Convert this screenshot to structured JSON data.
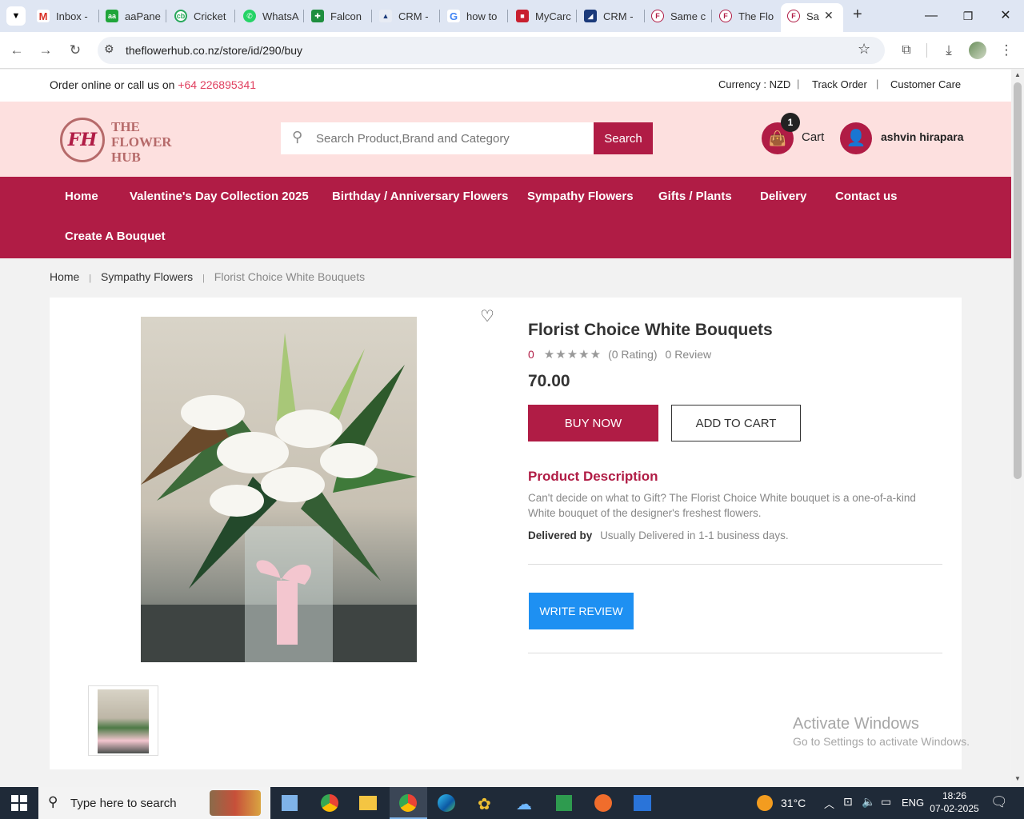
{
  "browser": {
    "tabs": [
      {
        "title": "Inbox -",
        "icon": "gmail-icon"
      },
      {
        "title": "aaPane",
        "icon": "aapanel-icon"
      },
      {
        "title": "Cricket",
        "icon": "cricket-icon"
      },
      {
        "title": "WhatsA",
        "icon": "whatsapp-icon"
      },
      {
        "title": "Falcon",
        "icon": "falcon-icon"
      },
      {
        "title": "CRM -",
        "icon": "crm-icon"
      },
      {
        "title": "how to",
        "icon": "google-icon"
      },
      {
        "title": "MyCarc",
        "icon": "mycard-icon"
      },
      {
        "title": "CRM -",
        "icon": "crm-icon"
      },
      {
        "title": "Same c",
        "icon": "flowerhub-icon"
      },
      {
        "title": "The Flo",
        "icon": "flowerhub-icon"
      },
      {
        "title": "Sa",
        "icon": "flowerhub-icon"
      }
    ],
    "url": "theflowerhub.co.nz/store/id/290/buy"
  },
  "topbar": {
    "call_text": "Order online or call us on",
    "phone": "+64 226895341",
    "currency": "Currency : NZD",
    "track_order": "Track Order",
    "customer_care": "Customer Care"
  },
  "header": {
    "logo_line1": "THE",
    "logo_line2": "FLOWER",
    "logo_line3": "HUB",
    "search_placeholder": "Search Product,Brand and Category",
    "search_button": "Search",
    "cart_label": "Cart",
    "cart_count": "1",
    "user_name": "ashvin hirapara"
  },
  "nav": {
    "items": [
      "Home",
      "Valentine's Day Collection 2025",
      "Birthday / Anniversary Flowers",
      "Sympathy Flowers",
      "Gifts / Plants",
      "Delivery",
      "Contact us",
      "Create A Bouquet"
    ]
  },
  "breadcrumb": {
    "home": "Home",
    "category": "Sympathy Flowers",
    "current": "Florist Choice White Bouquets"
  },
  "product": {
    "title": "Florist Choice White Bouquets",
    "rating_value": "0",
    "rating_stars": 0,
    "rating_text": "(0 Rating)",
    "review_text": "0 Review",
    "price": "70.00",
    "buy_now": "BUY NOW",
    "add_to_cart": "ADD TO CART",
    "description_heading": "Product Description",
    "description": "Can't decide on what to Gift? The Florist Choice White bouquet is a one-of-a-kind White bouquet of the designer's freshest flowers.",
    "delivered_label": "Delivered by",
    "delivered_text": "Usually Delivered in 1-1 business days.",
    "write_review": "WRITE REVIEW"
  },
  "watermark": {
    "line1": "Activate Windows",
    "line2": "Go to Settings to activate Windows."
  },
  "taskbar": {
    "search_placeholder": "Type here to search",
    "weather": "31°C",
    "language": "ENG",
    "time": "18:26",
    "date": "07-02-2025"
  },
  "colors": {
    "brand": "#b01c45",
    "header_bg": "#fde0df",
    "review_button": "#1e90f2"
  }
}
